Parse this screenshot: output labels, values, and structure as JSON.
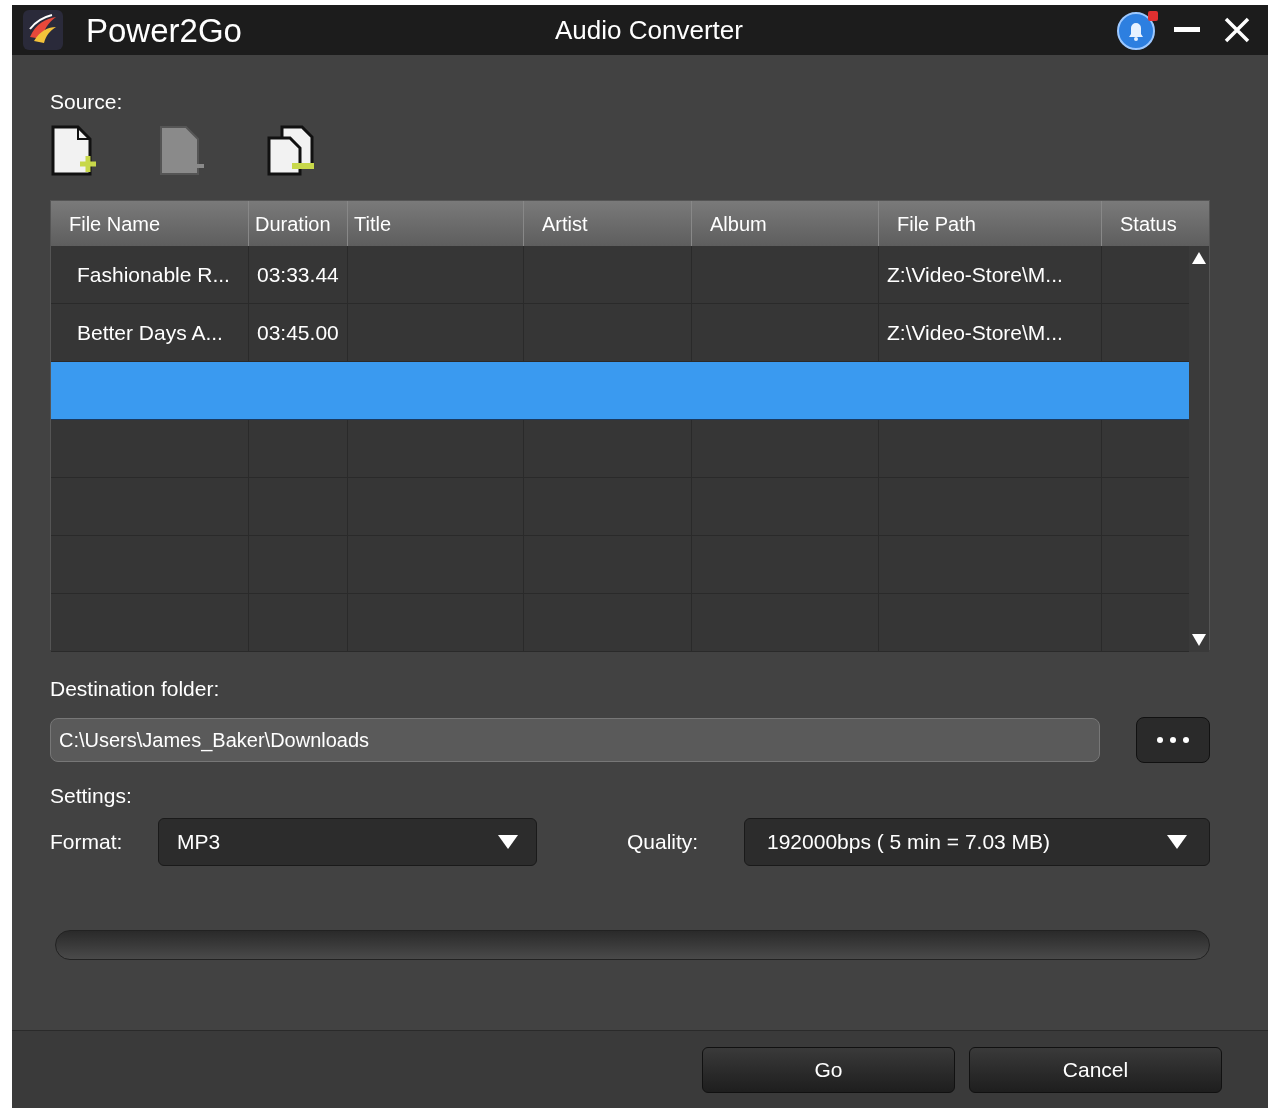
{
  "window": {
    "app_name": "Power2Go",
    "title": "Audio Converter"
  },
  "source": {
    "label": "Source:"
  },
  "table": {
    "columns": [
      "File Name",
      "Duration",
      "Title",
      "Artist",
      "Album",
      "File Path",
      "Status"
    ],
    "rows": [
      {
        "file_name": "Fashionable R...",
        "duration": "03:33.44",
        "file_path": "Z:\\Video-Store\\M...",
        "selected": false
      },
      {
        "file_name": "Better Days A...",
        "duration": "03:45.00",
        "file_path": "Z:\\Video-Store\\M...",
        "selected": false
      },
      {
        "selected": true
      },
      {
        "selected": false
      },
      {
        "selected": false
      },
      {
        "selected": false
      },
      {
        "selected": false
      }
    ]
  },
  "destination": {
    "label": "Destination folder:",
    "value": "C:\\Users\\James_Baker\\Downloads"
  },
  "settings": {
    "label": "Settings:",
    "format_label": "Format:",
    "format": "MP3",
    "quality_label": "Quality:",
    "quality": "192000bps ( 5 min = 7.03 MB)"
  },
  "progress": {
    "level": 0
  },
  "buttons": [
    "Go",
    "Cancel"
  ]
}
